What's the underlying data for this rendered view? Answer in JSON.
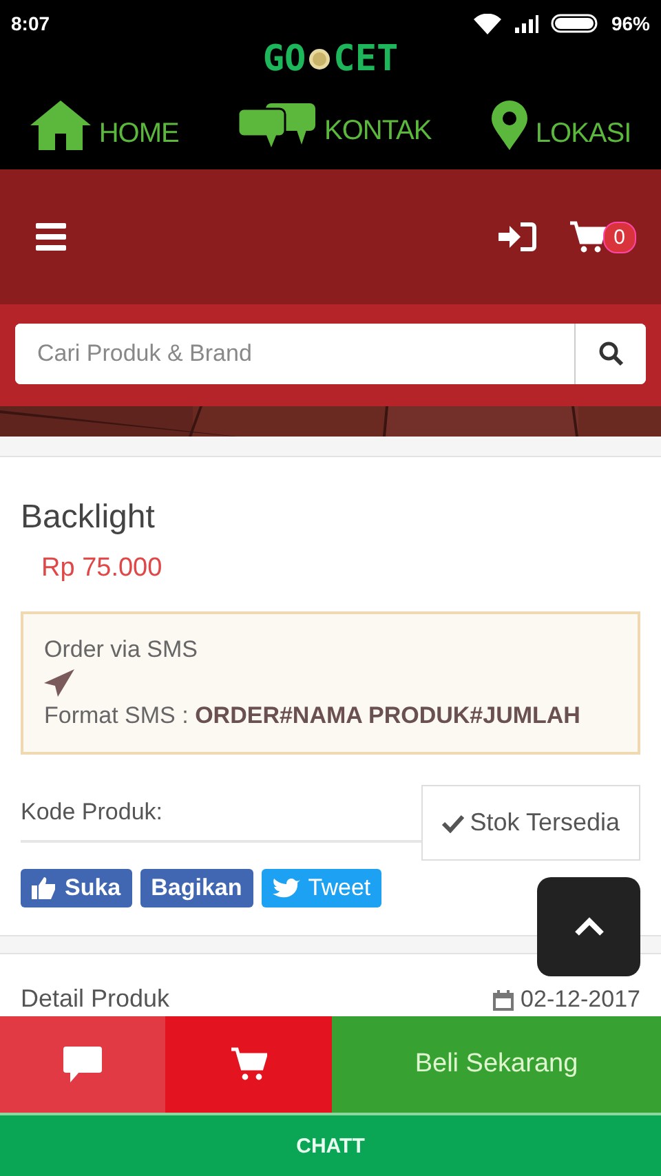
{
  "status_bar": {
    "time": "8:07",
    "battery": "96%"
  },
  "brand": {
    "logo_left": "GO",
    "logo_right": "CET"
  },
  "nav": [
    {
      "label": "HOME",
      "kind": "home"
    },
    {
      "label": "KONTAK",
      "kind": "chat"
    },
    {
      "label": "LOKASI",
      "kind": "pin"
    }
  ],
  "header": {
    "cart_count": "0"
  },
  "search": {
    "placeholder": "Cari Produk & Brand"
  },
  "product": {
    "name": "Backlight",
    "price": "Rp 75.000"
  },
  "sms_box": {
    "title": "Order via SMS",
    "format": "Format SMS : **ORDER#NAMA PRODUK#JUMLAH**"
  },
  "code_label": "Kode Produk:",
  "stock": "Stok Tersedia",
  "social": [
    {
      "label": "Suka",
      "kind": "like"
    },
    {
      "label": "Bagikan",
      "kind": "share"
    },
    {
      "label": "Tweet",
      "kind": "tweet"
    }
  ],
  "detail": {
    "title": "Detail Produk",
    "date": "02-12-2017"
  },
  "actions": {
    "buy": "Beli Sekarang",
    "chat": "CHATT"
  }
}
